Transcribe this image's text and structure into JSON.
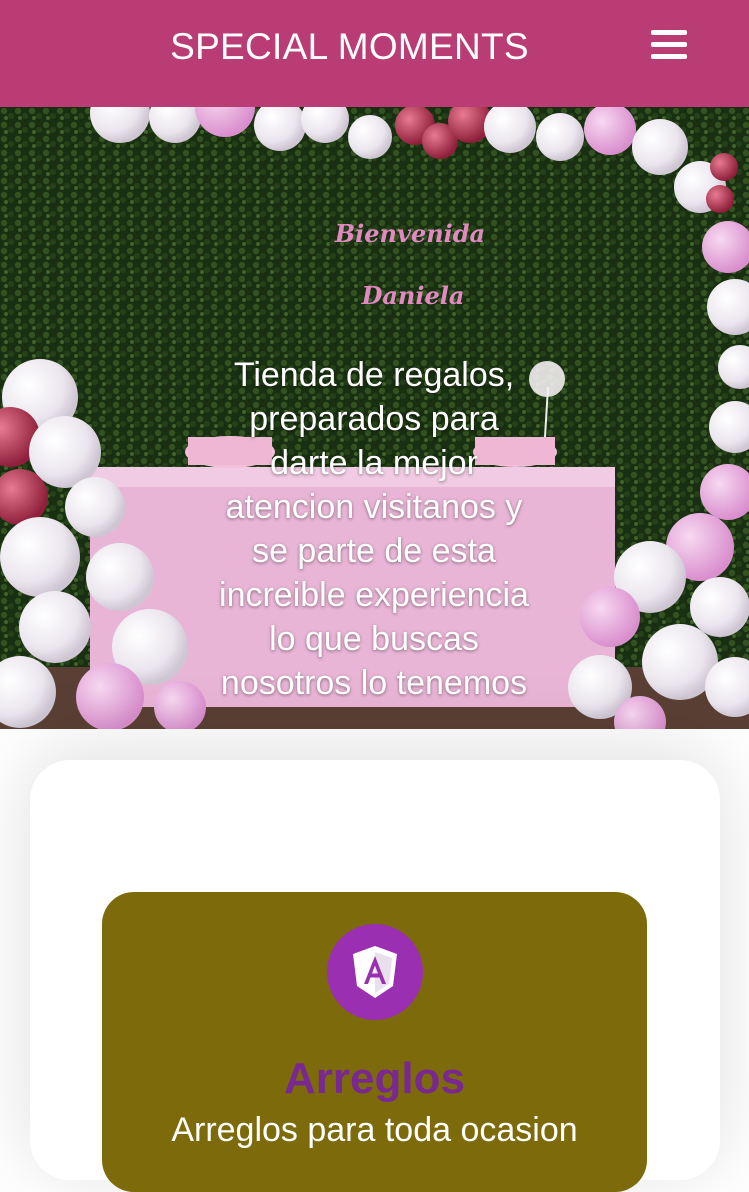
{
  "header": {
    "brand": "SPECIAL MOMENTS",
    "menu_icon": "hamburger-menu-icon",
    "background": "#b93d74"
  },
  "hero": {
    "sign_line1": "Bienvenida",
    "sign_line2": "Daniela",
    "text": "Tienda de regalos, preparados para darte la mejor atencion visitanos y se parte de esta increible experiencia lo que buscas nosotros lo tenemos"
  },
  "card": {
    "icon": "angular-icon",
    "title": "Arreglos",
    "subtitle": "Arreglos para toda ocasion",
    "background": "#7d6a0b",
    "title_color": "#7a2891"
  }
}
